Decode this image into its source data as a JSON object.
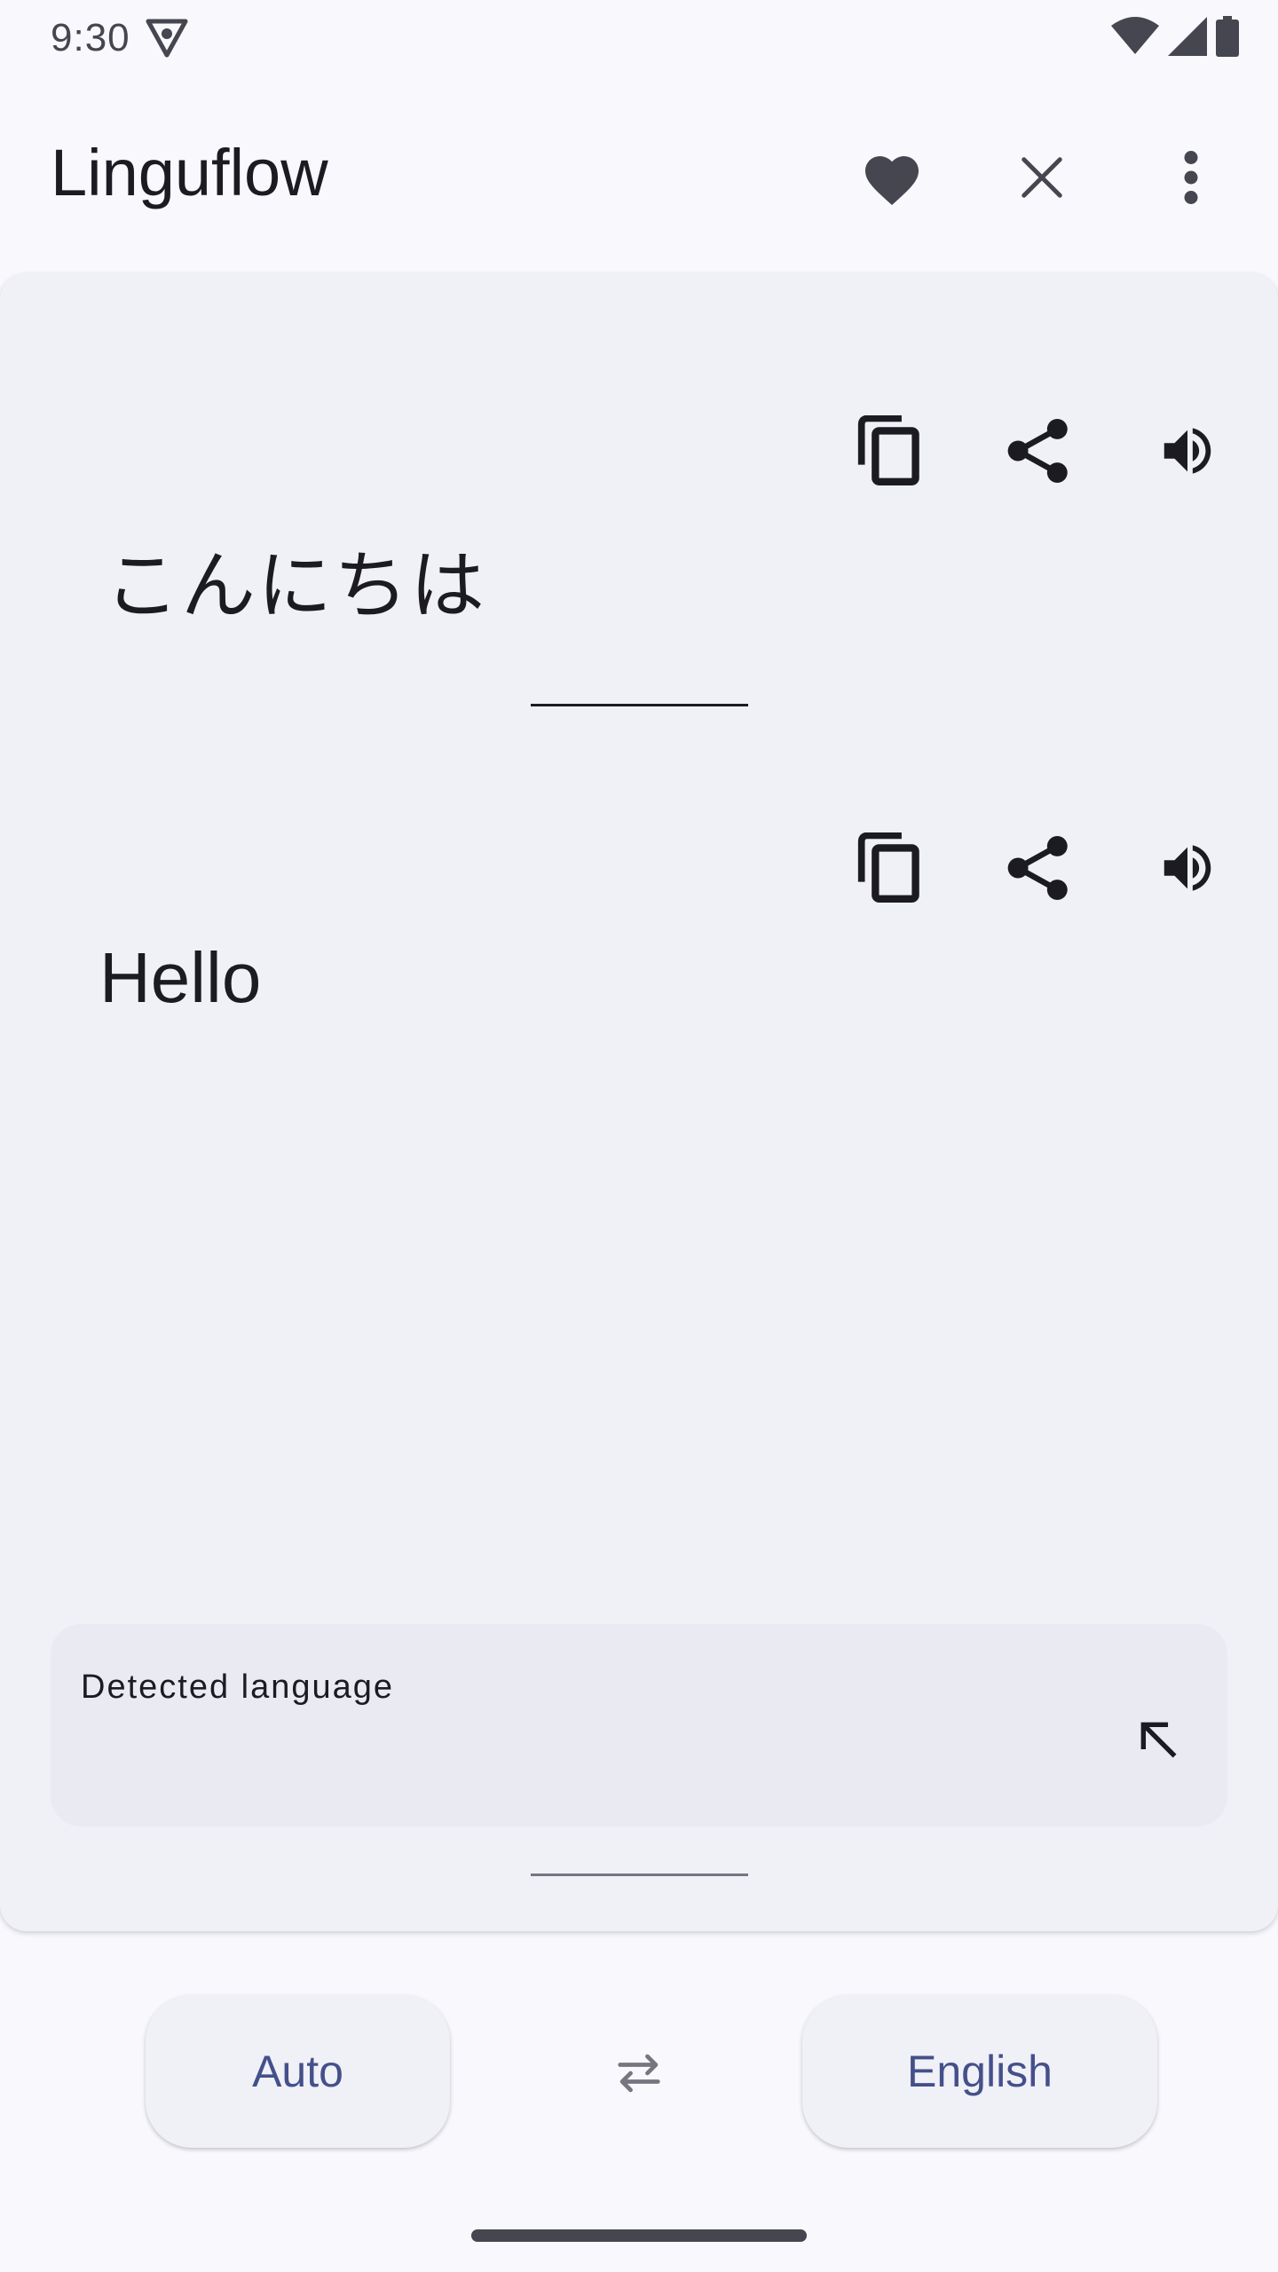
{
  "status_bar": {
    "time": "9:30",
    "icons": [
      "app-notification-icon",
      "wifi-icon",
      "cellular-icon",
      "battery-icon"
    ]
  },
  "app_bar": {
    "title": "Linguflow",
    "actions": [
      "favorite-icon",
      "close-icon",
      "more-vert-icon"
    ]
  },
  "source": {
    "text": "こんにちは",
    "actions": [
      "copy-icon",
      "share-icon",
      "volume-icon"
    ]
  },
  "translation": {
    "text": "Hello",
    "actions": [
      "copy-icon",
      "share-icon",
      "volume-icon"
    ]
  },
  "detected": {
    "label": "Detected language",
    "action_icon": "arrow-up-left-icon"
  },
  "languages": {
    "source": "Auto",
    "target": "English",
    "swap_icon": "swap-horiz-icon"
  },
  "colors": {
    "background": "#f8f8fd",
    "card": "#f0f0f7",
    "accent": "#44508a",
    "icon": "#1b1b21"
  }
}
